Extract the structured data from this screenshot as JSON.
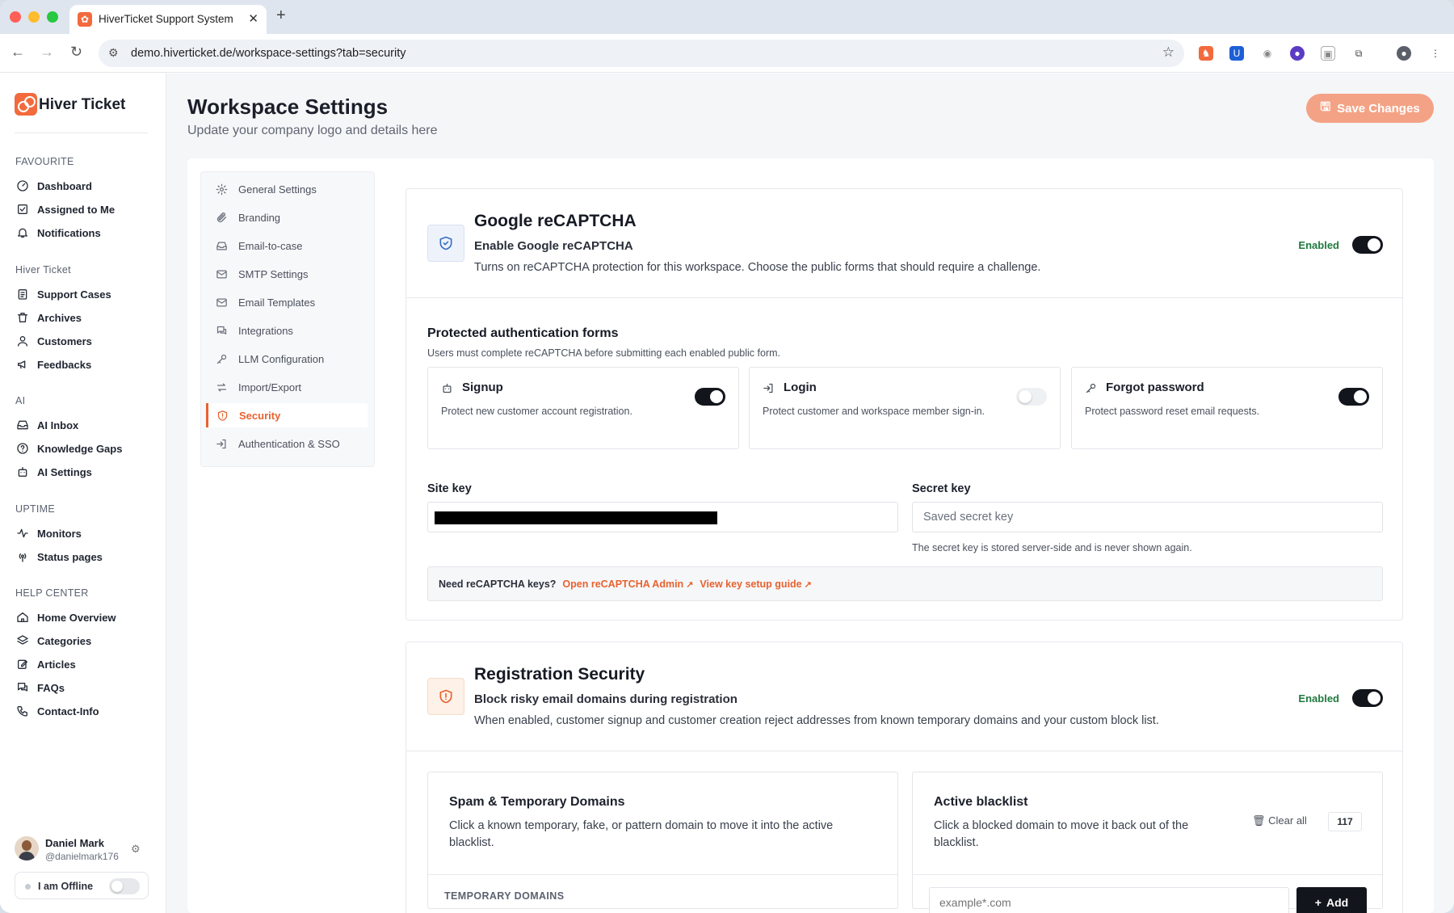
{
  "browser": {
    "tab_title": "HiverTicket Support System",
    "url": "demo.hiverticket.de/workspace-settings?tab=security"
  },
  "brand": {
    "name": "Hiver Ticket",
    "accent": "#e8622f"
  },
  "sidebar": {
    "sections": [
      {
        "title": "FAVOURITE",
        "items": [
          "Dashboard",
          "Assigned to Me",
          "Notifications"
        ]
      },
      {
        "title": "Hiver Ticket",
        "items": [
          "Support Cases",
          "Archives",
          "Customers",
          "Feedbacks"
        ]
      },
      {
        "title": "AI",
        "items": [
          "AI Inbox",
          "Knowledge Gaps",
          "AI Settings"
        ]
      },
      {
        "title": "UPTIME",
        "items": [
          "Monitors",
          "Status pages"
        ]
      },
      {
        "title": "HELP CENTER",
        "items": [
          "Home Overview",
          "Categories",
          "Articles",
          "FAQs",
          "Contact-Info"
        ]
      }
    ],
    "user": {
      "name": "Daniel Mark",
      "handle": "@danielmark176",
      "status": "I am Offline"
    }
  },
  "header": {
    "title": "Workspace Settings",
    "subtitle": "Update your company logo and details here",
    "save_label": "Save Changes"
  },
  "settings_menu": [
    "General Settings",
    "Branding",
    "Email-to-case",
    "SMTP Settings",
    "Email Templates",
    "Integrations",
    "LLM Configuration",
    "Import/Export",
    "Security",
    "Authentication & SSO"
  ],
  "recaptcha": {
    "title": "Google reCAPTCHA",
    "subtitle": "Enable Google reCAPTCHA",
    "description": "Turns on reCAPTCHA protection for this workspace. Choose the public forms that should require a challenge.",
    "enabled_label": "Enabled",
    "forms_heading": "Protected authentication forms",
    "forms_description": "Users must complete reCAPTCHA before submitting each enabled public form.",
    "forms": [
      {
        "title": "Signup",
        "description": "Protect new customer account registration.",
        "enabled": true
      },
      {
        "title": "Login",
        "description": "Protect customer and workspace member sign-in.",
        "enabled": false
      },
      {
        "title": "Forgot password",
        "description": "Protect password reset email requests.",
        "enabled": true
      }
    ],
    "site_key_label": "Site key",
    "secret_key_label": "Secret key",
    "secret_key_placeholder": "Saved secret key",
    "secret_key_hint": "The secret key is stored server-side and is never shown again.",
    "keys_question": "Need reCAPTCHA keys?",
    "admin_link": "Open reCAPTCHA Admin",
    "guide_link": "View key setup guide"
  },
  "registration": {
    "title": "Registration Security",
    "subtitle": "Block risky email domains during registration",
    "description": "When enabled, customer signup and customer creation reject addresses from known temporary domains and your custom block list.",
    "enabled_label": "Enabled",
    "spam": {
      "title": "Spam & Temporary Domains",
      "description": "Click a known temporary, fake, or pattern domain to move it into the active blacklist.",
      "caption": "TEMPORARY DOMAINS"
    },
    "blacklist": {
      "title": "Active blacklist",
      "description": "Click a blocked domain to move it back out of the blacklist.",
      "clear_label": "Clear all",
      "count": "117",
      "input_placeholder": "example*.com",
      "add_label": "Add"
    }
  }
}
